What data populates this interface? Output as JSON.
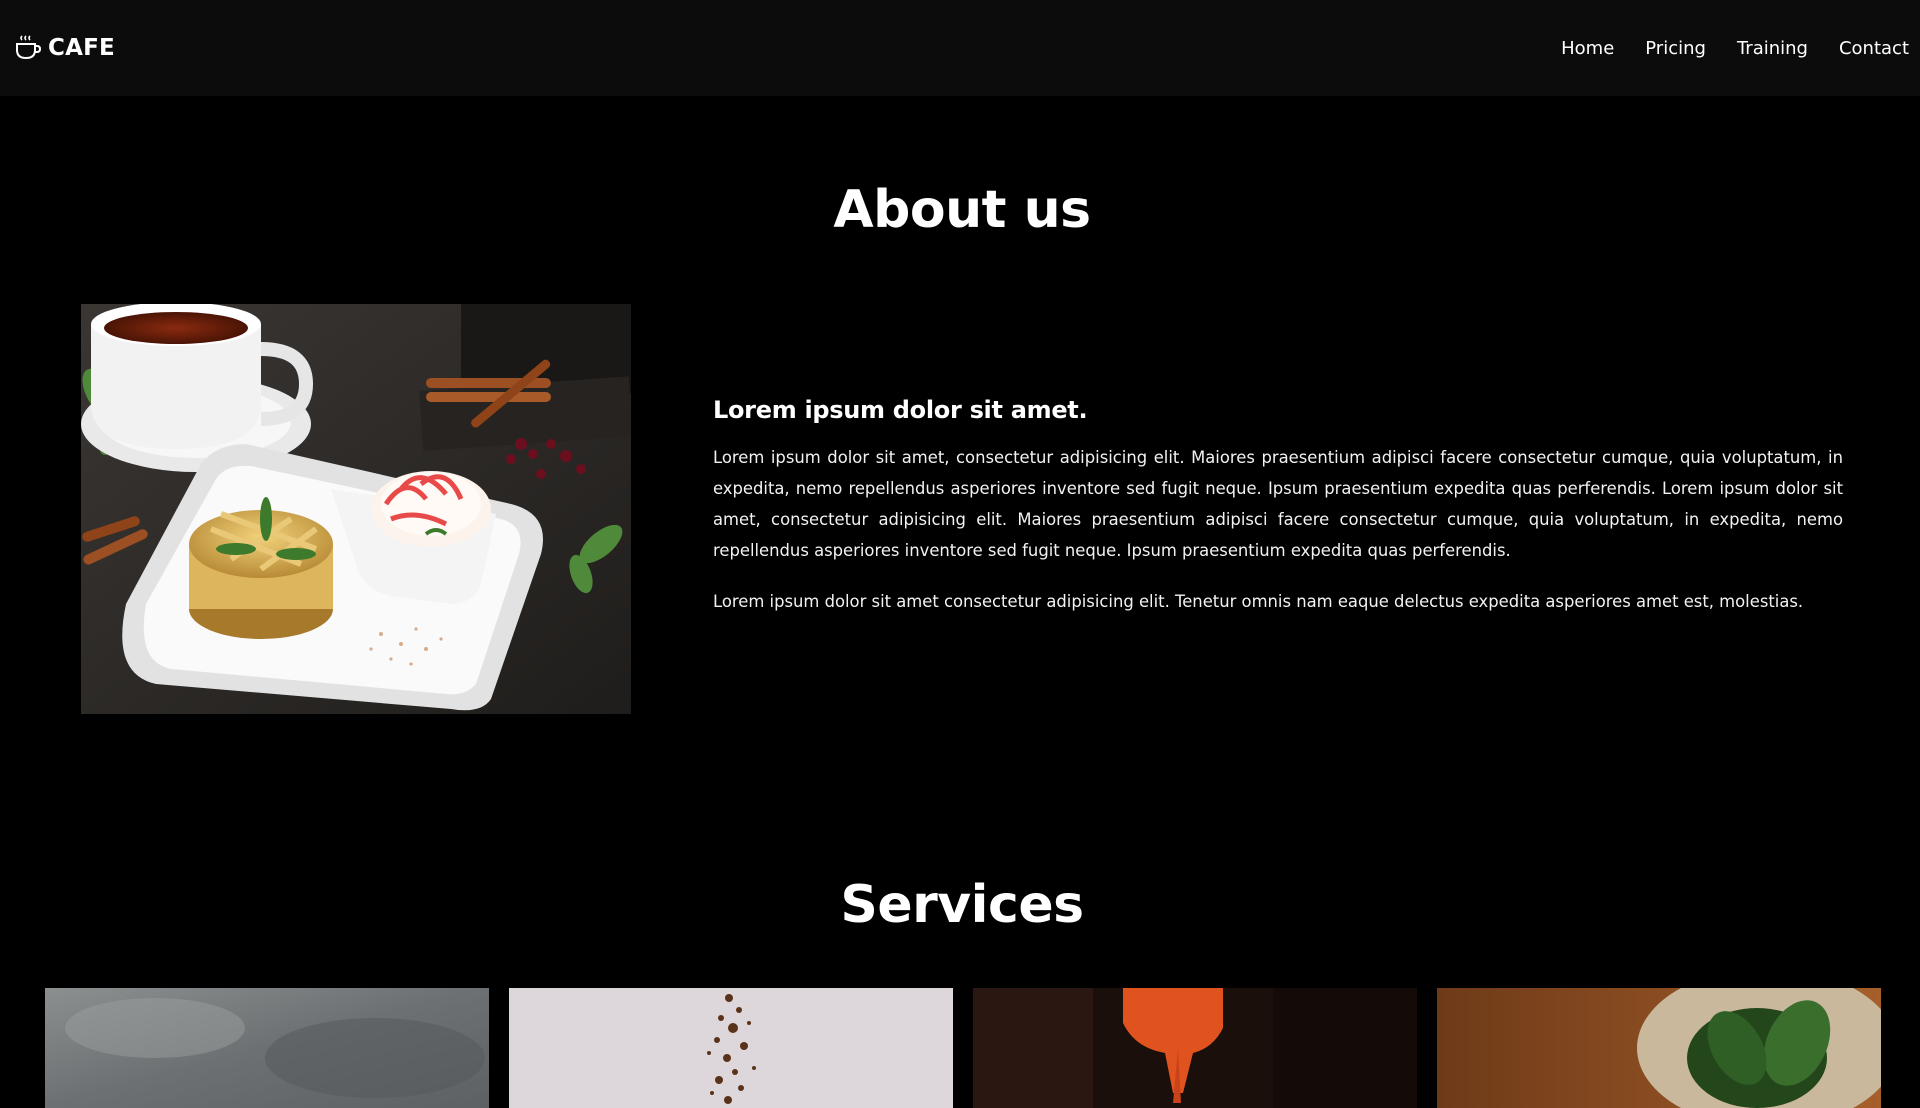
{
  "brand": {
    "name": "CAFE",
    "icon": "coffee-cup-icon"
  },
  "nav": {
    "items": [
      {
        "label": "Home"
      },
      {
        "label": "Pricing"
      },
      {
        "label": "Training"
      },
      {
        "label": "Contact"
      }
    ]
  },
  "about": {
    "title": "About us",
    "heading": "Lorem ipsum dolor sit amet.",
    "paragraph1": "Lorem ipsum dolor sit amet, consectetur adipisicing elit. Maiores praesentium adipisci facere consectetur cumque, quia voluptatum, in expedita, nemo repellendus asperiores inventore sed fugit neque. Ipsum praesentium expedita quas perferendis. Lorem ipsum dolor sit amet, consectetur adipisicing elit. Maiores praesentium adipisci facere consectetur cumque, quia voluptatum, in expedita, nemo repellendus asperiores inventore sed fugit neque. Ipsum praesentium expedita quas perferendis.",
    "paragraph2": "Lorem ipsum dolor sit amet consectetur adipisicing elit. Tenetur omnis nam eaque delectus expedita asperiores amet est, molestias.",
    "image": "dessert-plate-with-tea-photo"
  },
  "services": {
    "title": "Services",
    "cards": [
      {
        "image": "stone-texture-photo"
      },
      {
        "image": "coffee-grounds-falling-photo"
      },
      {
        "image": "red-dispenser-photo"
      },
      {
        "image": "wooden-board-leaves-photo"
      }
    ]
  },
  "colors": {
    "background": "#000000",
    "navbar": "#0c0c0c",
    "text": "#ffffff"
  }
}
